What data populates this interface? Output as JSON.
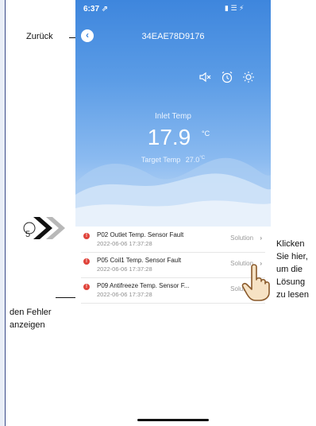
{
  "annotations": {
    "back_label": "Zurück",
    "errors_label_line1": "den Fehler",
    "errors_label_line2": "anzeigen",
    "click_label_line1": "Klicken",
    "click_label_line2": "Sie hier,",
    "click_label_line3": "um die",
    "click_label_line4": "Lösung",
    "click_label_line5": "zu lesen",
    "step_number": "5"
  },
  "status_bar": {
    "time": "6:37 ⇗",
    "right": "▮ ☰ ⚡"
  },
  "header": {
    "device_id": "34EAE78D9176"
  },
  "toolbar_icons": [
    "mute-icon",
    "alarm-clock-icon",
    "sun-icon"
  ],
  "hero": {
    "inlet_label": "Inlet Temp",
    "inlet_value": "17.9",
    "inlet_unit": "°C",
    "target_label": "Target Temp",
    "target_value": "27.0",
    "target_unit": "°C"
  },
  "faults": [
    {
      "name": "P02 Outlet Temp. Sensor Fault",
      "date": "2022-06-06 17:37:28",
      "solution": "Solution"
    },
    {
      "name": "P05 Coil1 Temp. Sensor Fault",
      "date": "2022-06-06 17:37:28",
      "solution": "Solution"
    },
    {
      "name": "P09 Antifreeze Temp. Sensor F...",
      "date": "2022-06-06 17:37:28",
      "solution": "Solution"
    }
  ],
  "colors": {
    "brand_blue": "#3e86dd",
    "error_red": "#e0433a"
  }
}
